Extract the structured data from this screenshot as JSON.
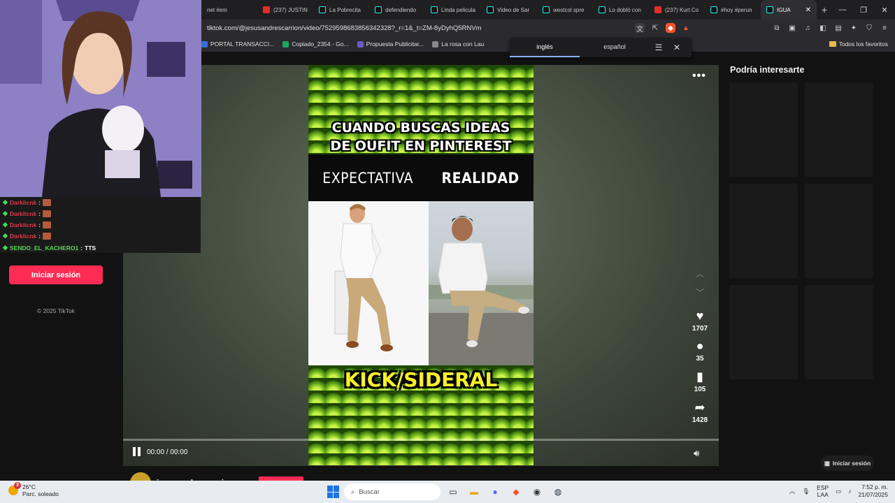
{
  "browser": {
    "tabs": [
      {
        "label": "net #em",
        "type": "plain"
      },
      {
        "label": "(237) JUSTIN",
        "type": "yt"
      },
      {
        "label": "La Pobrecita",
        "type": "tt"
      },
      {
        "label": "defendiendo",
        "type": "tt"
      },
      {
        "label": "Linda pelicula",
        "type": "tt"
      },
      {
        "label": "Video de Sar",
        "type": "tt"
      },
      {
        "label": "westcol spre",
        "type": "tt"
      },
      {
        "label": "Lo dobló con",
        "type": "tt"
      },
      {
        "label": "(237) Kurt Co",
        "type": "yt"
      },
      {
        "label": "#hoy #perun",
        "type": "tt"
      },
      {
        "label": "IGUA",
        "type": "active"
      }
    ],
    "new_tab": "+",
    "url": "tiktok.com/@jesusandrescarrion/video/7529598683856342328?_r=1&_t=ZM-8yDyhQ5RNVm",
    "bookmarks": [
      "PORTAL TRANSACCI...",
      "Copiado_2354 - Go...",
      "Propuesta Publicitar...",
      "La rosa con Lau"
    ],
    "bookmarks_right": "Todos los favoritos",
    "translate": {
      "tab_from": "inglés",
      "tab_to": "español"
    }
  },
  "video": {
    "caption_line1": "CUANDO BUSCAS IDEAS",
    "caption_line2": "DE OUFIT EN PINTEREST",
    "label_left": "EXPECTATIVA",
    "label_right": "REALIDAD",
    "watermark": "KICK/SIDERAL",
    "time": "00:00 / 00:00"
  },
  "actions": {
    "likes": "1707",
    "comments": "35",
    "saves": "105",
    "shares": "1428"
  },
  "author": {
    "name": "jesusandrescarrion"
  },
  "sidebar": {
    "title": "Podría interesarte",
    "login_small": "Iniciar sesión"
  },
  "left": {
    "login_button": "Iniciar sesión",
    "copyright": "© 2025 TikTok",
    "chat": [
      {
        "user": "Darklicnk",
        "msg": ""
      },
      {
        "user": "Darklicnk",
        "msg": ""
      },
      {
        "user": "Darklicnk",
        "msg": ""
      },
      {
        "user": "Darklicnk",
        "msg": ""
      },
      {
        "user": "SENDO_EL_KACHERO1",
        "msg": "TTS"
      }
    ]
  },
  "taskbar": {
    "weather_temp": "26°C",
    "weather_desc": "Parc. soleado",
    "weather_badge": "3",
    "search_placeholder": "Buscar",
    "lang_line1": "ESP",
    "lang_line2": "LAA",
    "time": "7:52 p. m.",
    "date": "21/07/2025"
  }
}
